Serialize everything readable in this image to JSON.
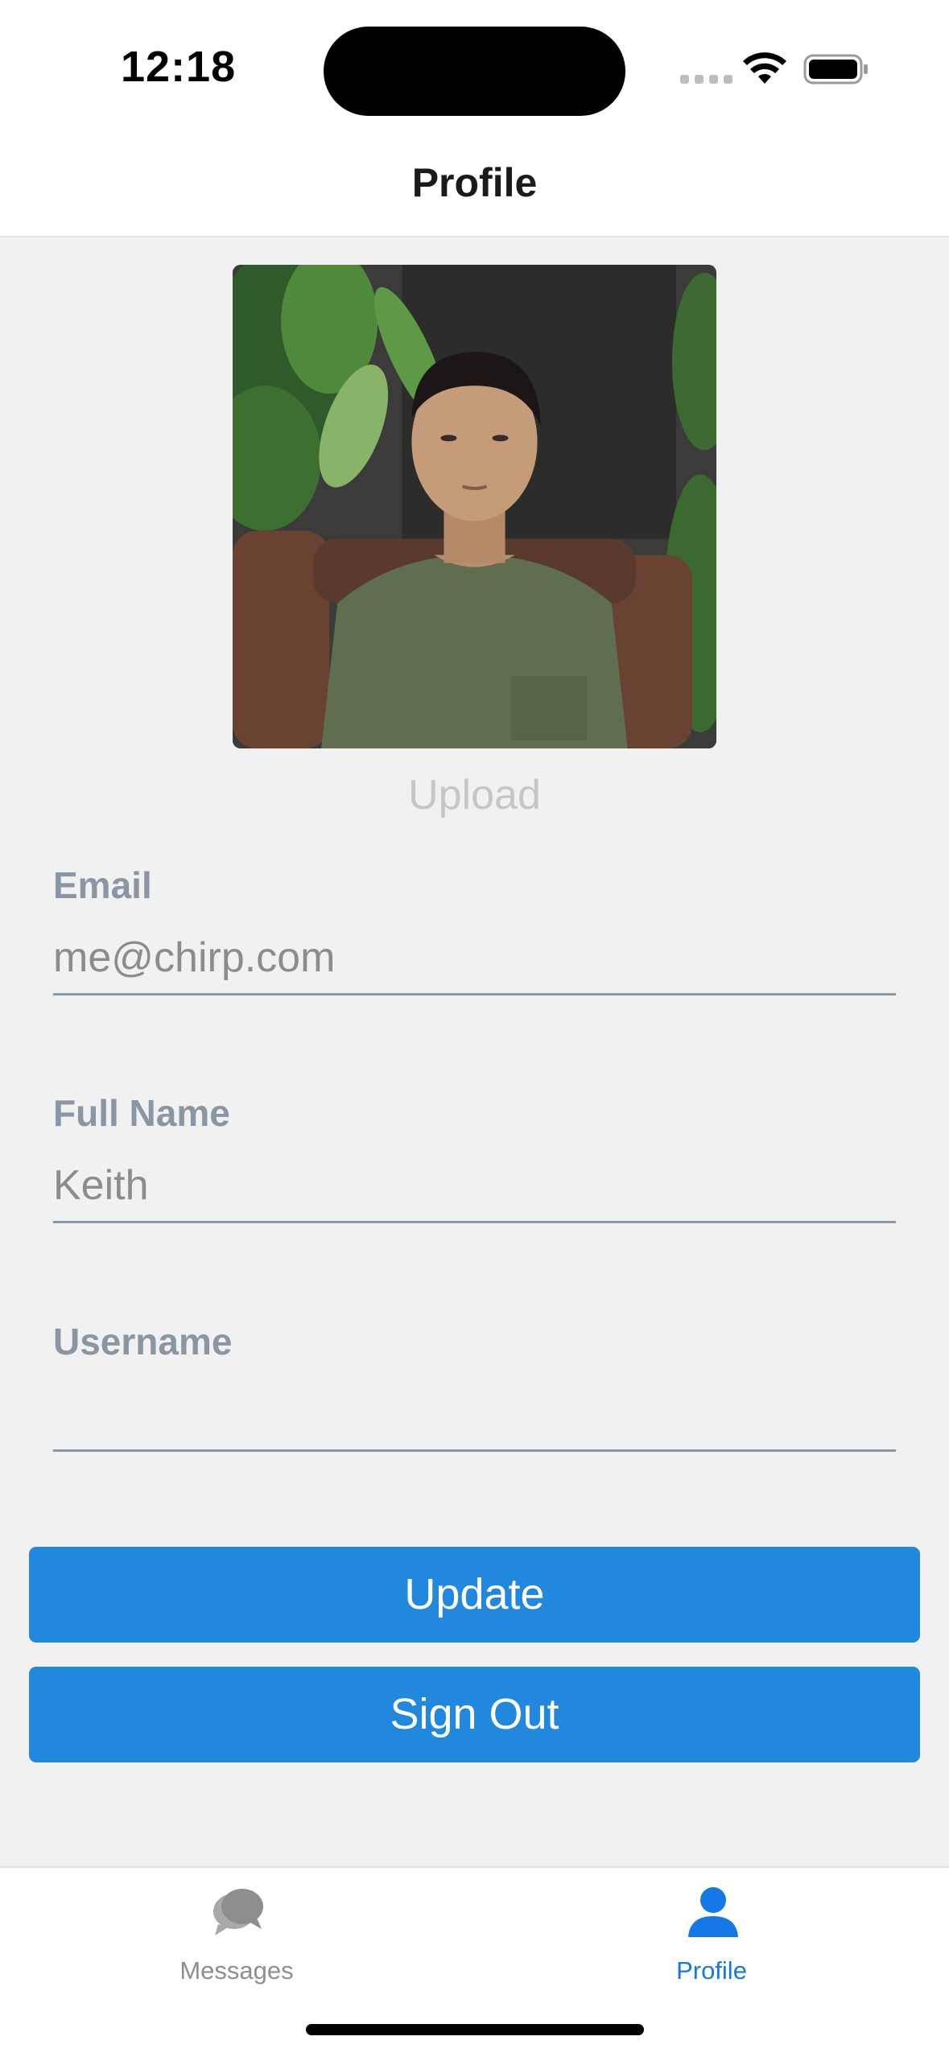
{
  "status_bar": {
    "time": "12:18"
  },
  "header": {
    "title": "Profile"
  },
  "profile": {
    "upload_label": "Upload"
  },
  "form": {
    "email": {
      "label": "Email",
      "value": "me@chirp.com"
    },
    "full_name": {
      "label": "Full Name",
      "value": "Keith"
    },
    "username": {
      "label": "Username",
      "value": ""
    }
  },
  "buttons": {
    "update": "Update",
    "sign_out": "Sign Out"
  },
  "tab_bar": {
    "items": [
      {
        "label": "Messages",
        "icon": "chat-bubbles-icon",
        "active": false
      },
      {
        "label": "Profile",
        "icon": "person-icon",
        "active": true
      }
    ]
  },
  "colors": {
    "accent": "#2288dd",
    "active_tab": "#1478e6",
    "background": "#f1f1f1",
    "label": "#8a96a3"
  }
}
